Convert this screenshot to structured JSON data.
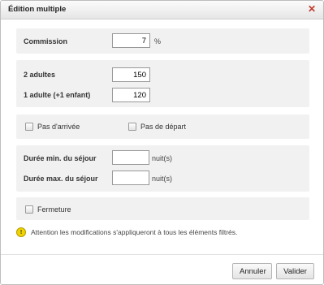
{
  "dialog": {
    "title": "Édition multiple",
    "close_icon": "close-icon"
  },
  "commission": {
    "label": "Commission",
    "value": "7",
    "unit": "%"
  },
  "prices": {
    "two_adults_label": "2 adultes",
    "two_adults_value": "150",
    "one_adult_label": "1 adulte (+1 enfant)",
    "one_adult_value": "120"
  },
  "arrival_departure": {
    "no_arrival_label": "Pas d'arrivée",
    "no_departure_label": "Pas de départ"
  },
  "stay": {
    "min_label": "Durée min. du séjour",
    "min_value": "",
    "min_unit": "nuit(s)",
    "max_label": "Durée max. du séjour",
    "max_value": "",
    "max_unit": "nuit(s)"
  },
  "closure": {
    "label": "Fermeture"
  },
  "notice": {
    "icon": "warning-icon",
    "text": "Attention les modifications s'appliqueront à tous les éléments filtrés."
  },
  "footer": {
    "cancel_label": "Annuler",
    "confirm_label": "Valider"
  }
}
